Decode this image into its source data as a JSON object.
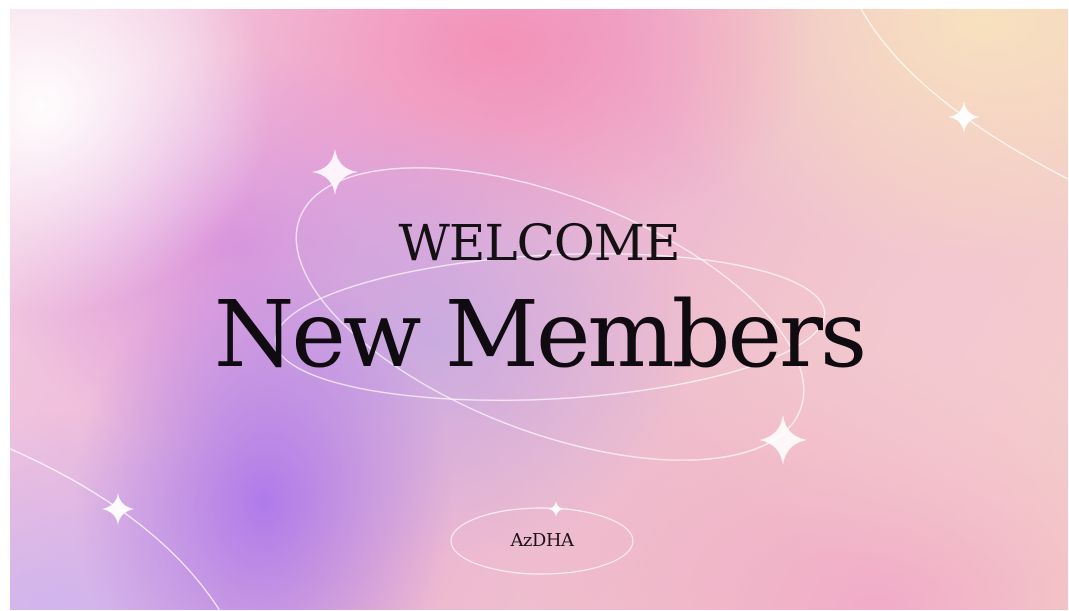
{
  "slide": {
    "welcome": "WELCOME",
    "headline": "New Members",
    "organization": "AzDHA"
  }
}
